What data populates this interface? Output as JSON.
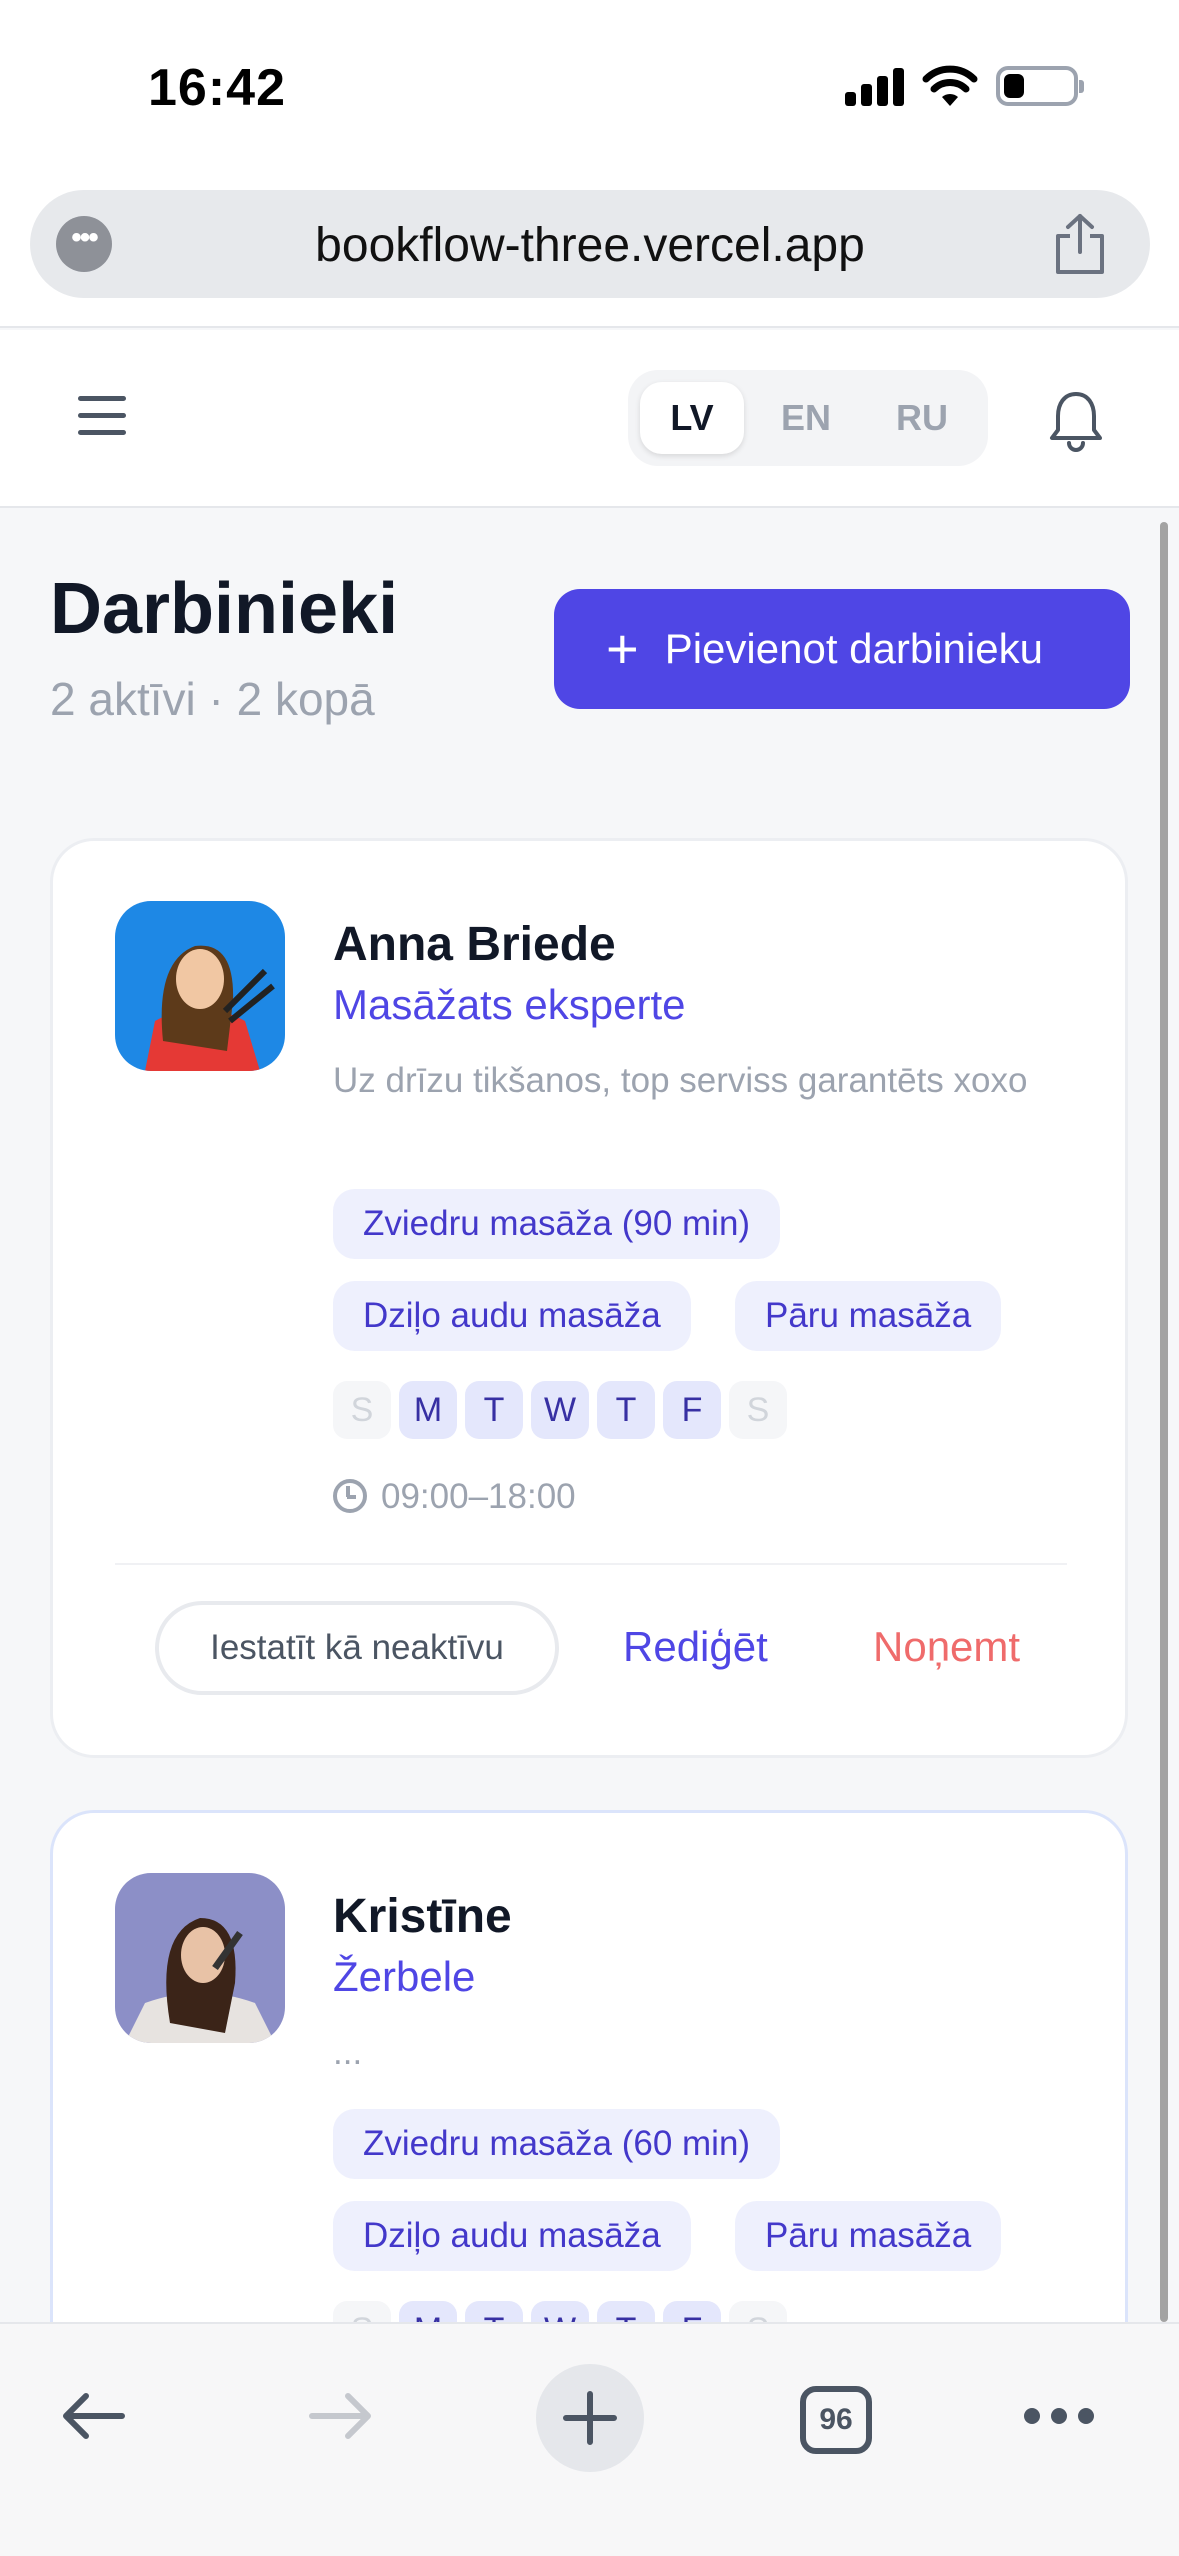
{
  "status_bar": {
    "time": "16:42"
  },
  "browser": {
    "url": "bookflow-three.vercel.app",
    "tabs_count": "96"
  },
  "header": {
    "languages": [
      {
        "label": "LV",
        "active": true
      },
      {
        "label": "EN",
        "active": false
      },
      {
        "label": "RU",
        "active": false
      }
    ]
  },
  "page": {
    "title": "Darbinieki",
    "subtitle": "2 aktīvi · 2 kopā",
    "add_button": "Pievienot darbinieku"
  },
  "employees": [
    {
      "name": "Anna Briede",
      "role": "Masāžats eksperte",
      "bio": "Uz drīzu tikšanos, top serviss garantēts xoxo",
      "services": [
        "Zviedru masāža (90 min)",
        "Dziļo audu masāža",
        "Pāru masāža"
      ],
      "days": [
        "S",
        "M",
        "T",
        "W",
        "T",
        "F",
        "S"
      ],
      "days_active": [
        false,
        true,
        true,
        true,
        true,
        true,
        false
      ],
      "hours": "09:00–18:00",
      "actions": {
        "set_inactive": "Iestatīt kā neaktīvu",
        "edit": "Rediģēt",
        "remove": "Noņemt"
      },
      "avatar_color": "#1e88e5"
    },
    {
      "name": "Kristīne",
      "role": "Žerbele",
      "bio": "...",
      "services": [
        "Zviedru masāža (60 min)",
        "Dziļo audu masāža",
        "Pāru masāža"
      ],
      "days": [
        "S",
        "M",
        "T",
        "W",
        "T",
        "F",
        "S"
      ],
      "days_active": [
        false,
        true,
        true,
        true,
        true,
        true,
        false
      ],
      "avatar_color": "#8c8fc7"
    }
  ],
  "colors": {
    "accent": "#4f46e5",
    "danger": "#ef6b6b",
    "muted": "#9ca3af"
  }
}
